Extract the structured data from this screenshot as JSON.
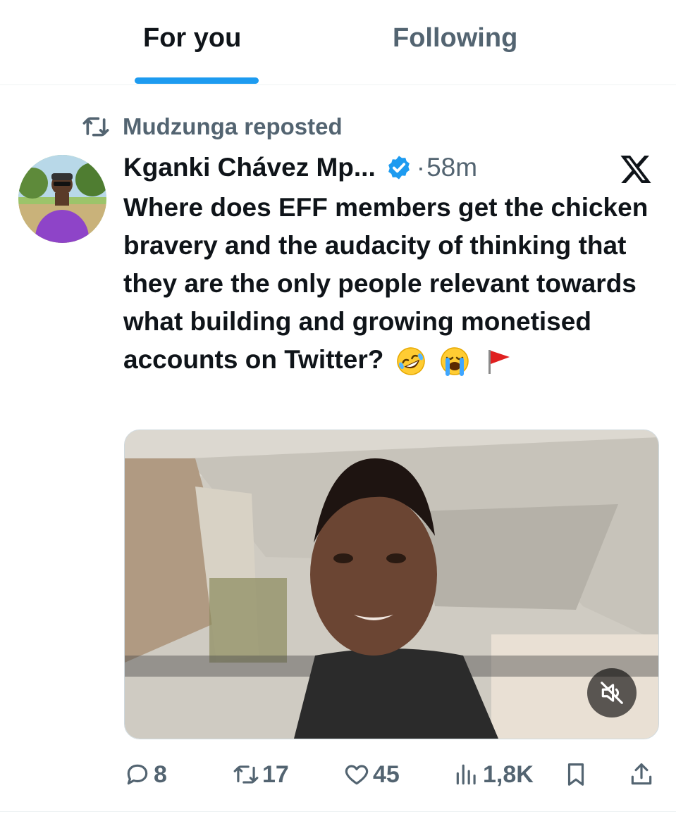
{
  "tabs": {
    "for_you": "For you",
    "following": "Following"
  },
  "repost": {
    "label": "Mudzunga reposted",
    "icon": "repost-icon"
  },
  "tweet": {
    "author": "Kganki Chávez Mp...",
    "verified": true,
    "separator": "·",
    "time": "58m",
    "text": "Where does EFF members get the chicken bravery and the audacity of thinking that they are the only people relevant towards what building and growing monetised accounts on Twitter?",
    "emojis": [
      "rolling-on-floor-laughing-emoji",
      "loudly-crying-emoji",
      "red-flag-emoji"
    ],
    "media": {
      "type": "video",
      "muted": true
    },
    "stats": {
      "replies": "8",
      "reposts": "17",
      "likes": "45",
      "views": "1,8K"
    }
  },
  "colors": {
    "accent": "#1d9bf0",
    "text_primary": "#0f1419",
    "text_secondary": "#536471",
    "divider": "#eff3f4"
  }
}
